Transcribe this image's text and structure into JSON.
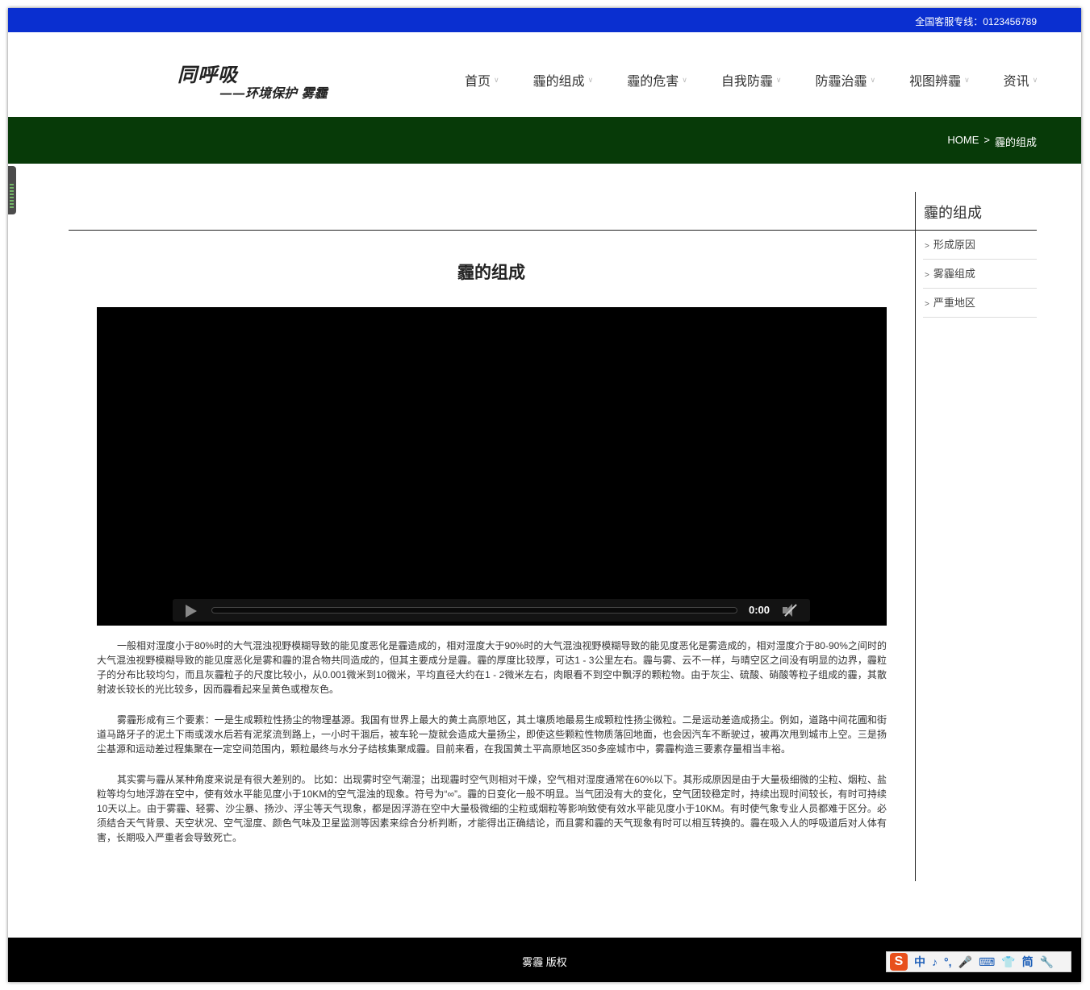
{
  "topbar": {
    "hotline": "全国客服专线：0123456789"
  },
  "logo": {
    "main": "同呼吸",
    "sub": "——环境保护 雾霾"
  },
  "nav": [
    {
      "label": "首页"
    },
    {
      "label": "霾的组成"
    },
    {
      "label": "霾的危害"
    },
    {
      "label": "自我防霾"
    },
    {
      "label": "防霾治霾"
    },
    {
      "label": "视图辨霾"
    },
    {
      "label": "资讯"
    }
  ],
  "caret": "∨",
  "breadcrumb": {
    "home": "HOME",
    "sep": ">",
    "current": "霾的组成"
  },
  "sidebar": {
    "title": "霾的组成",
    "arrow": ">",
    "items": [
      "形成原因",
      "雾霾组成",
      "严重地区"
    ]
  },
  "article": {
    "title": "霾的组成",
    "video": {
      "time": "0:00"
    },
    "paragraphs": [
      "一般相对湿度小于80%时的大气混浊视野模糊导致的能见度恶化是霾造成的，相对湿度大于90%时的大气混浊视野模糊导致的能见度恶化是雾造成的，相对湿度介于80-90%之间时的大气混浊视野模糊导致的能见度恶化是雾和霾的混合物共同造成的，但其主要成分是霾。霾的厚度比较厚，可达1 - 3公里左右。霾与雾、云不一样，与晴空区之间没有明显的边界，霾粒子的分布比较均匀，而且灰霾粒子的尺度比较小，从0.001微米到10微米，平均直径大约在1 - 2微米左右，肉眼看不到空中飘浮的颗粒物。由于灰尘、硫酸、硝酸等粒子组成的霾，其散射波长较长的光比较多，因而霾看起来呈黄色或橙灰色。",
      "雾霾形成有三个要素：一是生成颗粒性扬尘的物理基源。我国有世界上最大的黄土高原地区，其土壤质地最易生成颗粒性扬尘微粒。二是运动差造成扬尘。例如，道路中间花圃和街道马路牙子的泥土下雨或泼水后若有泥浆流到路上，一小时干涸后，被车轮一旋就会造成大量扬尘，即使这些颗粒性物质落回地面，也会因汽车不断驶过，被再次甩到城市上空。三是扬尘基源和运动差过程集聚在一定空间范围内，颗粒最终与水分子结核集聚成霾。目前来看，在我国黄土平高原地区350多座城市中，雾霾构造三要素存量相当丰裕。",
      "其实雾与霾从某种角度来说是有很大差别的。 比如：出现雾时空气潮湿；出现霾时空气则相对干燥，空气相对湿度通常在60%以下。其形成原因是由于大量极细微的尘粒、烟粒、盐粒等均匀地浮游在空中，使有效水平能见度小于10KM的空气混浊的现象。符号为“∞”。霾的日变化一般不明显。当气团没有大的变化，空气团较稳定时，持续出现时间较长，有时可持续10天以上。由于雾霾、轻雾、沙尘暴、扬沙、浮尘等天气现象，都是因浮游在空中大量极微细的尘粒或烟粒等影响致使有效水平能见度小于10KM。有时使气象专业人员都难于区分。必须结合天气背景、天空状况、空气湿度、颜色气味及卫星监测等因素来综合分析判断，才能得出正确结论，而且雾和霾的天气现象有时可以相互转换的。霾在吸入人的呼吸道后对人体有害，长期吸入严重者会导致死亡。"
    ]
  },
  "footer": {
    "copyright": "雾霾 版权"
  },
  "ime": {
    "logo": "S",
    "items": [
      "中",
      "♪",
      "°,",
      "🎤",
      "⌨",
      "👕",
      "简",
      "🔧"
    ]
  }
}
